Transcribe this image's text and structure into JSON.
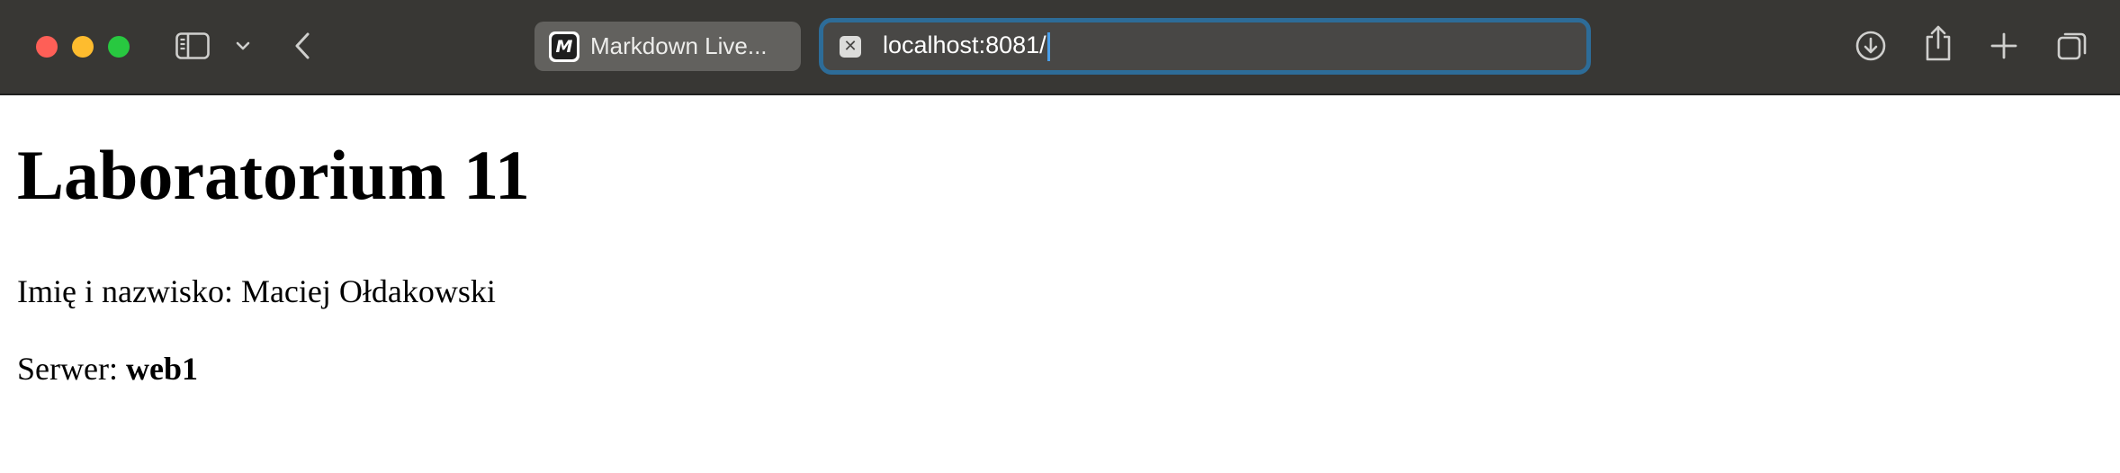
{
  "browser": {
    "tab": {
      "favicon_letter": "M",
      "title": "Markdown Live..."
    },
    "address_bar": {
      "site_icon": "✕",
      "url": "localhost:8081/"
    },
    "icons": {
      "sidebar": "sidebar-icon",
      "sidebar_menu": "chevron-down-icon",
      "back": "chevron-left-icon",
      "downloads": "download-icon",
      "share": "share-icon",
      "new_tab": "plus-icon",
      "tab_overview": "tab-overview-icon"
    },
    "colors": {
      "toolbar_bg": "#383734",
      "address_focus": "#2d6c98",
      "close": "#fe5f57",
      "minimize": "#febc2e",
      "zoom": "#28c840"
    }
  },
  "page": {
    "heading": "Laboratorium 11",
    "name_line": "Imię i nazwisko: Maciej Ołdakowski",
    "server_label": "Serwer: ",
    "server_value": "web1"
  }
}
